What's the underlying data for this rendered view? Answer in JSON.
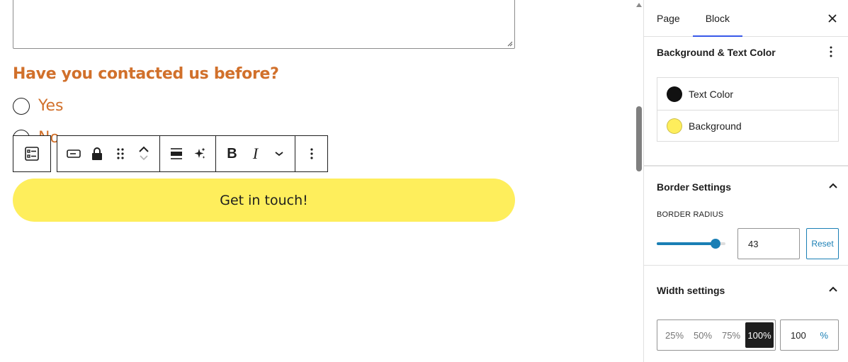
{
  "canvas": {
    "question": "Have you contacted us before?",
    "options": [
      {
        "label": "Yes"
      },
      {
        "label": "No"
      }
    ],
    "cta_label": "Get in touch!",
    "cta_color": "#feee5c",
    "accent_text_color": "#d1702b"
  },
  "toolbar": {
    "icons": [
      "form-block-icon",
      "input-type-icon",
      "lock-icon",
      "drag-handle-icon",
      "move-up-icon",
      "move-down-icon",
      "justify-icon",
      "ai-sparkle-icon",
      "bold-icon",
      "italic-icon",
      "more-rich-text-icon",
      "options-icon"
    ],
    "bold_glyph": "B",
    "italic_glyph": "I"
  },
  "sidebar": {
    "tabs": [
      {
        "label": "Page",
        "active": false
      },
      {
        "label": "Block",
        "active": true
      }
    ],
    "color_panel": {
      "title": "Background & Text Color",
      "items": [
        {
          "label": "Text Color",
          "swatch": "#111111"
        },
        {
          "label": "Background",
          "swatch": "#feee5c"
        }
      ]
    },
    "border_panel": {
      "title": "Border Settings",
      "radius_label": "BORDER RADIUS",
      "radius_value": "43",
      "radius_slider_fraction": 0.86,
      "reset_label": "Reset"
    },
    "width_panel": {
      "title": "Width settings",
      "options": [
        {
          "label": "25%",
          "active": false
        },
        {
          "label": "50%",
          "active": false
        },
        {
          "label": "75%",
          "active": false
        },
        {
          "label": "100%",
          "active": true
        }
      ],
      "value": "100",
      "unit": "%"
    }
  },
  "colors": {
    "accent_blue": "#1a7fb5",
    "tab_indicator": "#3858e9"
  }
}
